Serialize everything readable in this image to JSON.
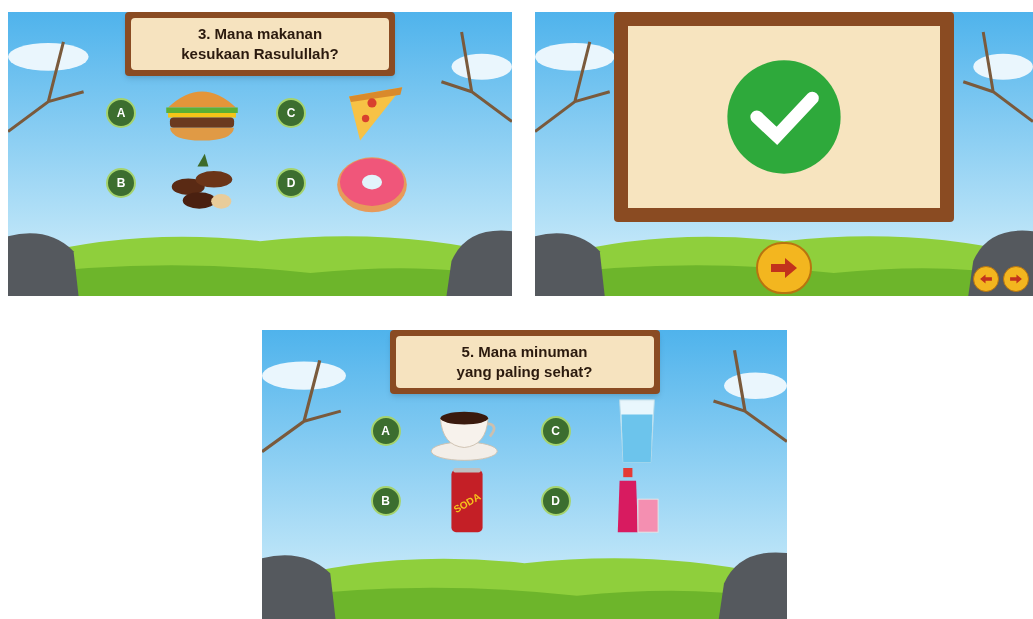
{
  "screens": [
    {
      "kind": "question",
      "question_lines": [
        "3. Mana makanan",
        "kesukaan Rasulullah?"
      ],
      "options": [
        {
          "letter": "A",
          "kind": "burger"
        },
        {
          "letter": "C",
          "kind": "pizza"
        },
        {
          "letter": "B",
          "kind": "dates"
        },
        {
          "letter": "D",
          "kind": "donut"
        }
      ]
    },
    {
      "kind": "feedback",
      "correct": true
    },
    {
      "kind": "question",
      "question_lines": [
        "5. Mana minuman",
        "yang paling sehat?"
      ],
      "options": [
        {
          "letter": "A",
          "kind": "coffee"
        },
        {
          "letter": "C",
          "kind": "water"
        },
        {
          "letter": "B",
          "kind": "soda",
          "label": "SODA"
        },
        {
          "letter": "D",
          "kind": "juice"
        }
      ]
    }
  ]
}
